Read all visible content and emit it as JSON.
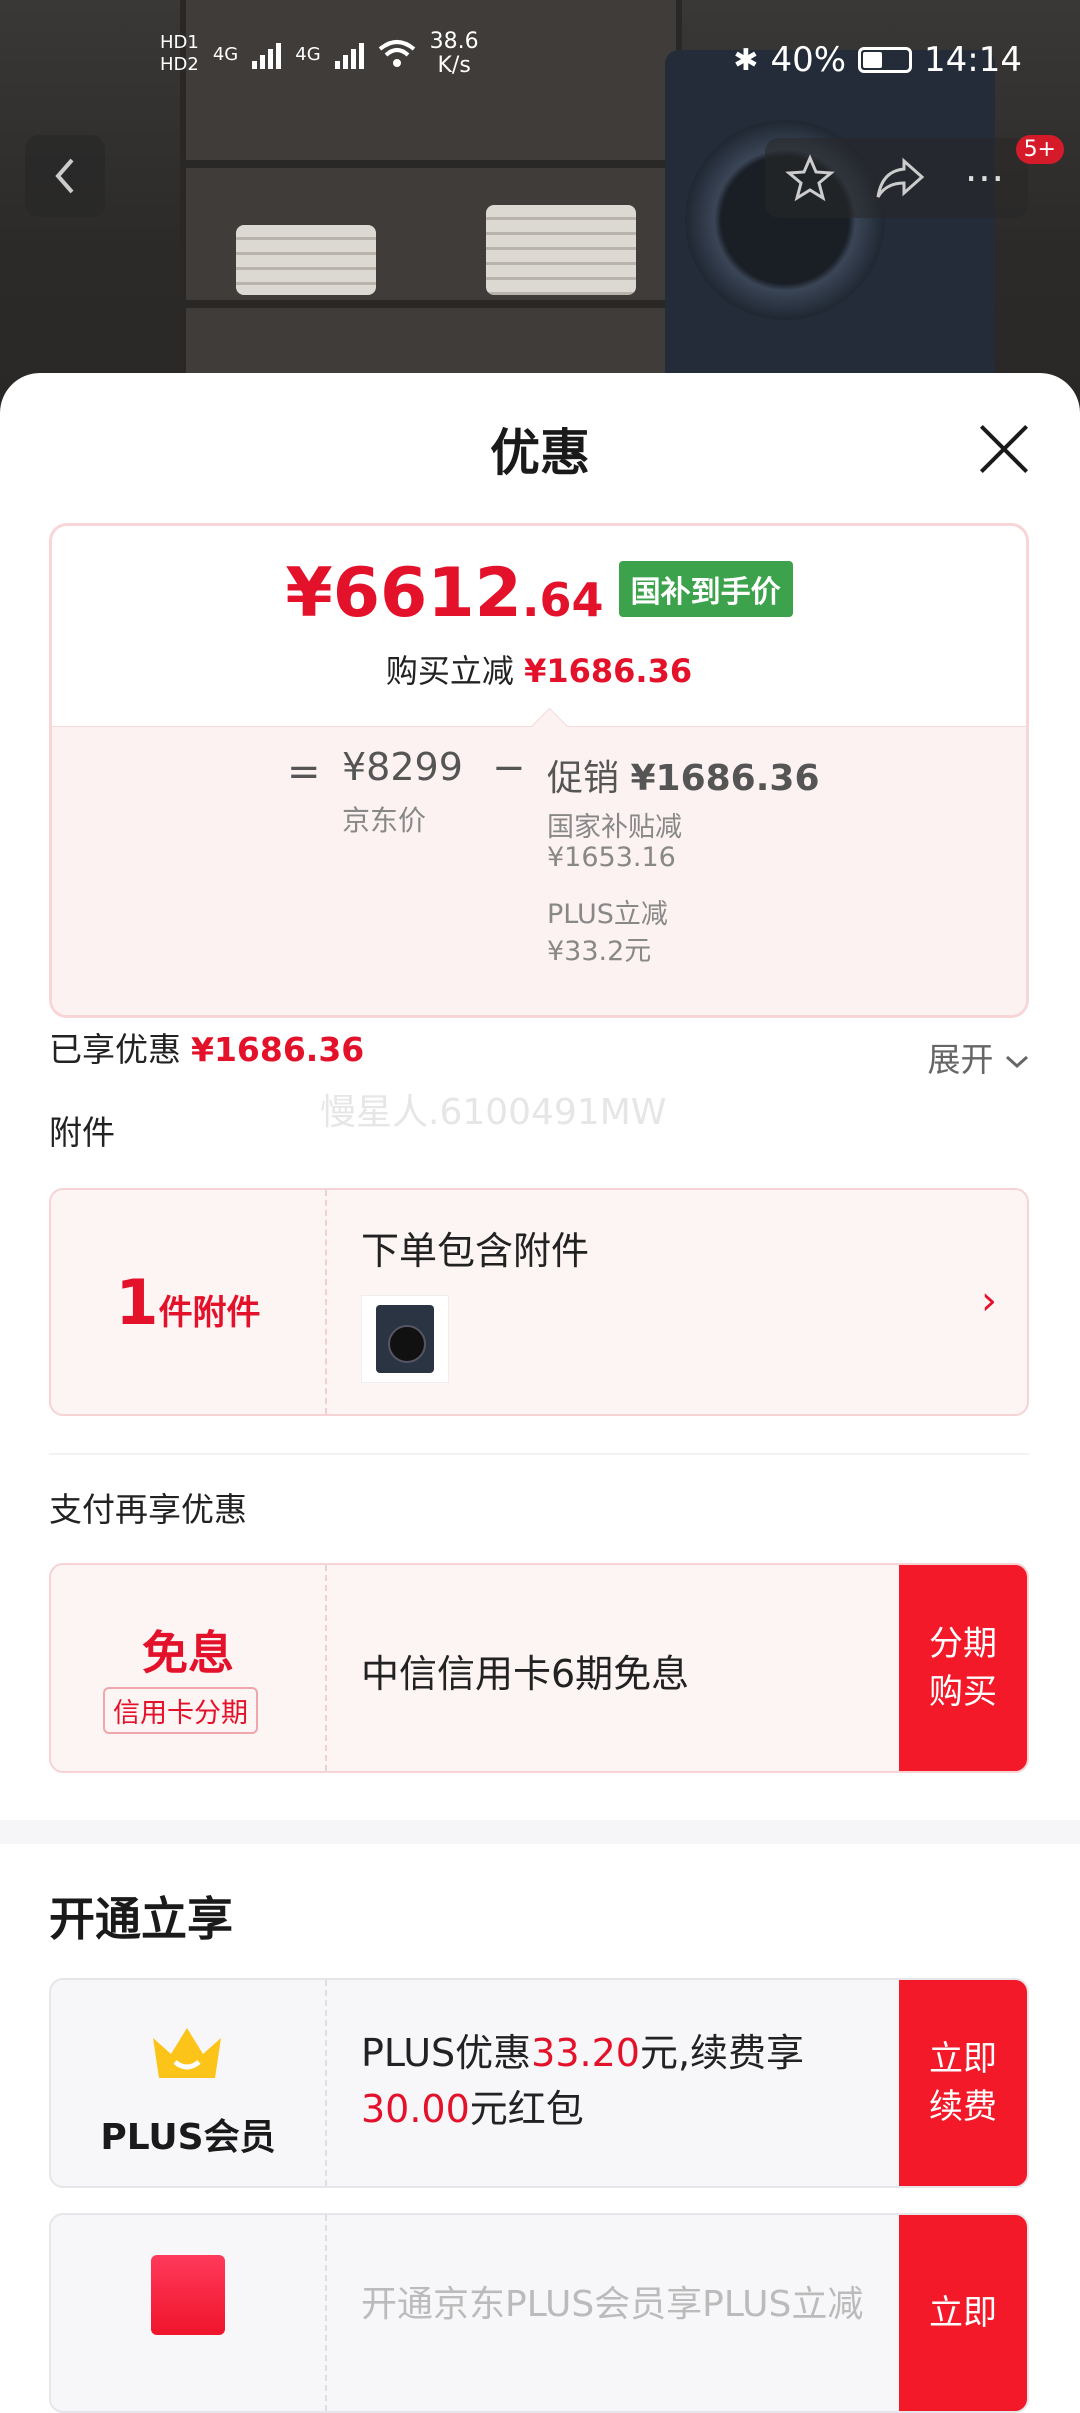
{
  "status_bar": {
    "hd1": "HD1",
    "hd2": "HD2",
    "net1": "4G",
    "net2": "4G",
    "speed_value": "38.6",
    "speed_unit": "K/s",
    "battery": "40%",
    "time": "14:14"
  },
  "nav": {
    "badge": "5+"
  },
  "sheet": {
    "title": "优惠"
  },
  "price_card": {
    "price_main": "¥6612",
    "price_decimal": ".64",
    "tag": "国补到手价",
    "reduce_label": "购买立减",
    "reduce_value": "¥1686.36",
    "eq": "=",
    "jd_price": "¥8299",
    "jd_label": "京东价",
    "minus": "−",
    "promo_label": "促销",
    "promo_value": "¥1686.36",
    "sub1_label": "国家补贴减",
    "sub1_value": "¥1653.16",
    "sub2_label": "PLUS立减",
    "sub2_value": "¥33.2元"
  },
  "enjoyed": {
    "label": "已享优惠",
    "value": "¥1686.36",
    "expand": "展开"
  },
  "watermark": "慢星人.6100491MW",
  "accessories": {
    "section": "附件",
    "count": "1",
    "count_unit": "件附件",
    "title": "下单包含附件"
  },
  "payment": {
    "section": "支付再享优惠",
    "big": "免息",
    "small": "信用卡分期",
    "text": "中信信用卡6期免息",
    "button_line1": "分期",
    "button_line2": "购买"
  },
  "open": {
    "title": "开通立享",
    "plus_name": "PLUS会员",
    "plus_text_1": "PLUS优惠",
    "plus_value_1": "33.20",
    "plus_text_2": "元,续费享",
    "plus_value_2": "30.00",
    "plus_text_3": "元红包",
    "button_line1": "立即",
    "button_line2": "续费",
    "card2_text": "开通京东PLUS会员享PLUS立减"
  }
}
